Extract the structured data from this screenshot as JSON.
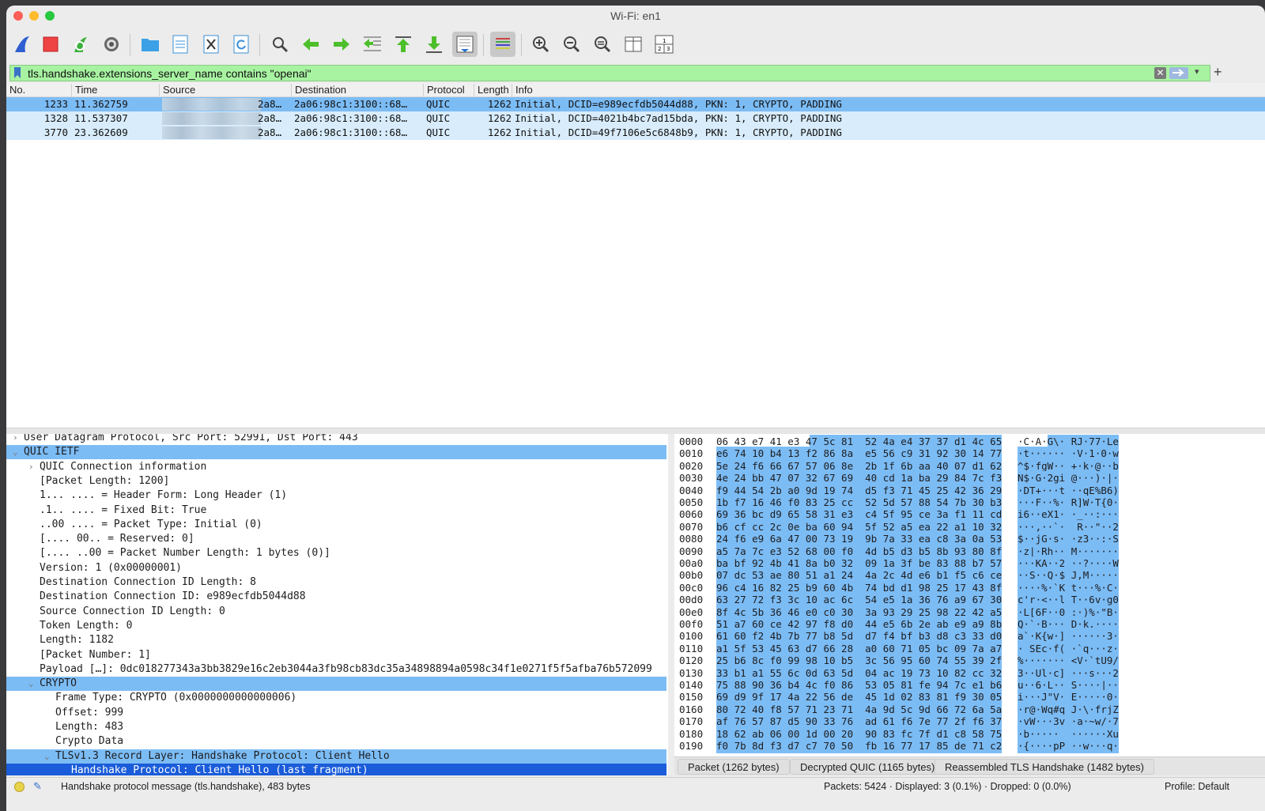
{
  "window": {
    "title": "Wi-Fi: en1"
  },
  "filter": {
    "value": "tls.handshake.extensions_server_name contains \"openai\""
  },
  "columns": [
    "No.",
    "Time",
    "Source",
    "Destination",
    "Protocol",
    "Length",
    "Info"
  ],
  "packets": [
    {
      "no": "1233",
      "time": "11.362759",
      "source_suffix": "2a8…",
      "destination": "2a06:98c1:3100::68…",
      "protocol": "QUIC",
      "length": "1262",
      "info": "Initial, DCID=e989ecfdb5044d88, PKN: 1, CRYPTO, PADDING"
    },
    {
      "no": "1328",
      "time": "11.537307",
      "source_suffix": "2a8…",
      "destination": "2a06:98c1:3100::68…",
      "protocol": "QUIC",
      "length": "1262",
      "info": "Initial, DCID=4021b4bc7ad15bda, PKN: 1, CRYPTO, PADDING"
    },
    {
      "no": "3770",
      "time": "23.362609",
      "source_suffix": "2a8…",
      "destination": "2a06:98c1:3100::68…",
      "protocol": "QUIC",
      "length": "1262",
      "info": "Initial, DCID=49f7106e5c6848b9, PKN: 1, CRYPTO, PADDING"
    }
  ],
  "details": [
    {
      "arrow": "›",
      "indent": 0,
      "text": "User Datagram Protocol, Src Port: 52991, Dst Port: 443",
      "style": ""
    },
    {
      "arrow": "⌄",
      "indent": 0,
      "text": "QUIC IETF",
      "style": "hl"
    },
    {
      "arrow": "›",
      "indent": 1,
      "text": "QUIC Connection information",
      "style": ""
    },
    {
      "arrow": "",
      "indent": 1,
      "text": "[Packet Length: 1200]",
      "style": ""
    },
    {
      "arrow": "",
      "indent": 1,
      "text": "1... .... = Header Form: Long Header (1)",
      "style": ""
    },
    {
      "arrow": "",
      "indent": 1,
      "text": ".1.. .... = Fixed Bit: True",
      "style": ""
    },
    {
      "arrow": "",
      "indent": 1,
      "text": "..00 .... = Packet Type: Initial (0)",
      "style": ""
    },
    {
      "arrow": "",
      "indent": 1,
      "text": "[.... 00.. = Reserved: 0]",
      "style": ""
    },
    {
      "arrow": "",
      "indent": 1,
      "text": "[.... ..00 = Packet Number Length: 1 bytes (0)]",
      "style": ""
    },
    {
      "arrow": "",
      "indent": 1,
      "text": "Version: 1 (0x00000001)",
      "style": ""
    },
    {
      "arrow": "",
      "indent": 1,
      "text": "Destination Connection ID Length: 8",
      "style": ""
    },
    {
      "arrow": "",
      "indent": 1,
      "text": "Destination Connection ID: e989ecfdb5044d88",
      "style": ""
    },
    {
      "arrow": "",
      "indent": 1,
      "text": "Source Connection ID Length: 0",
      "style": ""
    },
    {
      "arrow": "",
      "indent": 1,
      "text": "Token Length: 0",
      "style": ""
    },
    {
      "arrow": "",
      "indent": 1,
      "text": "Length: 1182",
      "style": ""
    },
    {
      "arrow": "",
      "indent": 1,
      "text": "[Packet Number: 1]",
      "style": ""
    },
    {
      "arrow": "",
      "indent": 1,
      "text": "Payload […]: 0dc018277343a3bb3829e16c2eb3044a3fb98cb83dc35a34898894a0598c34f1e0271f5f5afba76b572099",
      "style": ""
    },
    {
      "arrow": "⌄",
      "indent": 1,
      "text": "CRYPTO",
      "style": "hl"
    },
    {
      "arrow": "",
      "indent": 2,
      "text": "Frame Type: CRYPTO (0x0000000000000006)",
      "style": ""
    },
    {
      "arrow": "",
      "indent": 2,
      "text": "Offset: 999",
      "style": ""
    },
    {
      "arrow": "",
      "indent": 2,
      "text": "Length: 483",
      "style": ""
    },
    {
      "arrow": "",
      "indent": 2,
      "text": "Crypto Data",
      "style": ""
    },
    {
      "arrow": "⌄",
      "indent": 2,
      "text": "TLSv1.3 Record Layer: Handshake Protocol: Client Hello",
      "style": "hl"
    },
    {
      "arrow": "",
      "indent": 3,
      "text": "Handshake Protocol: Client Hello (last fragment)",
      "style": "selrow"
    }
  ],
  "hex": [
    {
      "off": "0000",
      "bytes": "06 43 e7 41 e3 47 5c 81  52 4a e4 37 37 d1 4c 65",
      "ascii": "·C·A·G\\· RJ·77·Le"
    },
    {
      "off": "0010",
      "bytes": "e6 74 10 b4 13 f2 86 8a  e5 56 c9 31 92 30 14 77",
      "ascii": "·t······ ·V·1·0·w"
    },
    {
      "off": "0020",
      "bytes": "5e 24 f6 66 67 57 06 8e  2b 1f 6b aa 40 07 d1 62",
      "ascii": "^$·fgW·· +·k·@··b"
    },
    {
      "off": "0030",
      "bytes": "4e 24 bb 47 07 32 67 69  40 cd 1a ba 29 84 7c f3",
      "ascii": "N$·G·2gi @···)·|·"
    },
    {
      "off": "0040",
      "bytes": "f9 44 54 2b a0 9d 19 74  d5 f3 71 45 25 42 36 29",
      "ascii": "·DT+···t ··qE%B6)"
    },
    {
      "off": "0050",
      "bytes": "1b f7 16 46 f0 83 25 cc  52 5d 57 88 54 7b 30 b3",
      "ascii": "···F··%· R]W·T{0·"
    },
    {
      "off": "0060",
      "bytes": "69 36 bc d9 65 58 31 e3  c4 5f 95 ce 3a f1 11 cd",
      "ascii": "i6··eX1· ·_··:···"
    },
    {
      "off": "0070",
      "bytes": "b6 cf cc 2c 0e ba 60 94  5f 52 a5 ea 22 a1 10 32",
      "ascii": "···,··`· _R··\"··2"
    },
    {
      "off": "0080",
      "bytes": "24 f6 e9 6a 47 00 73 19  9b 7a 33 ea c8 3a 0a 53",
      "ascii": "$··jG·s· ·z3··:·S"
    },
    {
      "off": "0090",
      "bytes": "a5 7a 7c e3 52 68 00 f0  4d b5 d3 b5 8b 93 80 8f",
      "ascii": "·z|·Rh·· M·······"
    },
    {
      "off": "00a0",
      "bytes": "ba bf 92 4b 41 8a b0 32  09 1a 3f be 83 88 b7 57",
      "ascii": "···KA··2 ··?····W"
    },
    {
      "off": "00b0",
      "bytes": "07 dc 53 ae 80 51 a1 24  4a 2c 4d e6 b1 f5 c6 ce",
      "ascii": "··S··Q·$ J,M·····"
    },
    {
      "off": "00c0",
      "bytes": "96 c4 16 82 25 b9 60 4b  74 bd d1 98 25 17 43 8f",
      "ascii": "····%·`K t···%·C·"
    },
    {
      "off": "00d0",
      "bytes": "63 27 72 f3 3c 10 ac 6c  54 e5 1a 36 76 a9 67 30",
      "ascii": "c'r·<··l T··6v·g0"
    },
    {
      "off": "00e0",
      "bytes": "8f 4c 5b 36 46 e0 c0 30  3a 93 29 25 98 22 42 a5",
      "ascii": "·L[6F··0 :·)%·\"B·"
    },
    {
      "off": "00f0",
      "bytes": "51 a7 60 ce 42 97 f8 d0  44 e5 6b 2e ab e9 a9 8b",
      "ascii": "Q·`·B··· D·k.····"
    },
    {
      "off": "0100",
      "bytes": "61 60 f2 4b 7b 77 b8 5d  d7 f4 bf b3 d8 c3 33 d0",
      "ascii": "a`·K{w·] ······3·"
    },
    {
      "off": "0110",
      "bytes": "a1 5f 53 45 63 d7 66 28  a0 60 71 05 bc 09 7a a7",
      "ascii": "·_SEc·f( ·`q···z·"
    },
    {
      "off": "0120",
      "bytes": "25 b6 8c f0 99 98 10 b5  3c 56 95 60 74 55 39 2f",
      "ascii": "%······· <V·`tU9/"
    },
    {
      "off": "0130",
      "bytes": "33 b1 a1 55 6c 0d 63 5d  04 ac 19 73 10 82 cc 32",
      "ascii": "3··Ul·c] ···s···2"
    },
    {
      "off": "0140",
      "bytes": "75 88 90 36 b4 4c f0 86  53 05 81 fe 94 7c e1 b6",
      "ascii": "u··6·L·· S····|··"
    },
    {
      "off": "0150",
      "bytes": "69 d9 9f 17 4a 22 56 de  45 1d 02 83 81 f9 30 05",
      "ascii": "i···J\"V· E·····0·"
    },
    {
      "off": "0160",
      "bytes": "80 72 40 f8 57 71 23 71  4a 9d 5c 9d 66 72 6a 5a",
      "ascii": "·r@·Wq#q J·\\·frjZ"
    },
    {
      "off": "0170",
      "bytes": "af 76 57 87 d5 90 33 76  ad 61 f6 7e 77 2f f6 37",
      "ascii": "·vW···3v ·a·~w/·7"
    },
    {
      "off": "0180",
      "bytes": "18 62 ab 06 00 1d 00 20  90 83 fc 7f d1 c8 58 75",
      "ascii": "·b·····  ······Xu"
    },
    {
      "off": "0190",
      "bytes": "f0 7b 8d f3 d7 c7 70 50  fb 16 77 17 85 de 71 c2",
      "ascii": "·{····pP ··w···q·"
    }
  ],
  "bytes_tabs": [
    "Packet (1262 bytes)",
    "Decrypted QUIC (1165 bytes)",
    "Reassembled TLS Handshake (1482 bytes)"
  ],
  "status": {
    "message": "Handshake protocol message (tls.handshake), 483 bytes",
    "counts": "Packets: 5424 · Displayed: 3 (0.1%) · Dropped: 0 (0.0%)",
    "profile": "Profile: Default"
  },
  "toolbar_icons": [
    "shark-fin-start-icon",
    "stop-icon",
    "restart-icon",
    "capture-options-gear-icon",
    "open-folder-icon",
    "save-file-icon",
    "close-file-icon",
    "reload-icon",
    "find-packet-icon",
    "go-back-icon",
    "go-forward-icon",
    "go-to-packet-icon",
    "first-packet-icon",
    "last-packet-icon",
    "autoscroll-icon",
    "colorize-icon",
    "zoom-in-icon",
    "zoom-out-icon",
    "normal-size-icon",
    "resize-columns-icon",
    "layout-icon"
  ]
}
